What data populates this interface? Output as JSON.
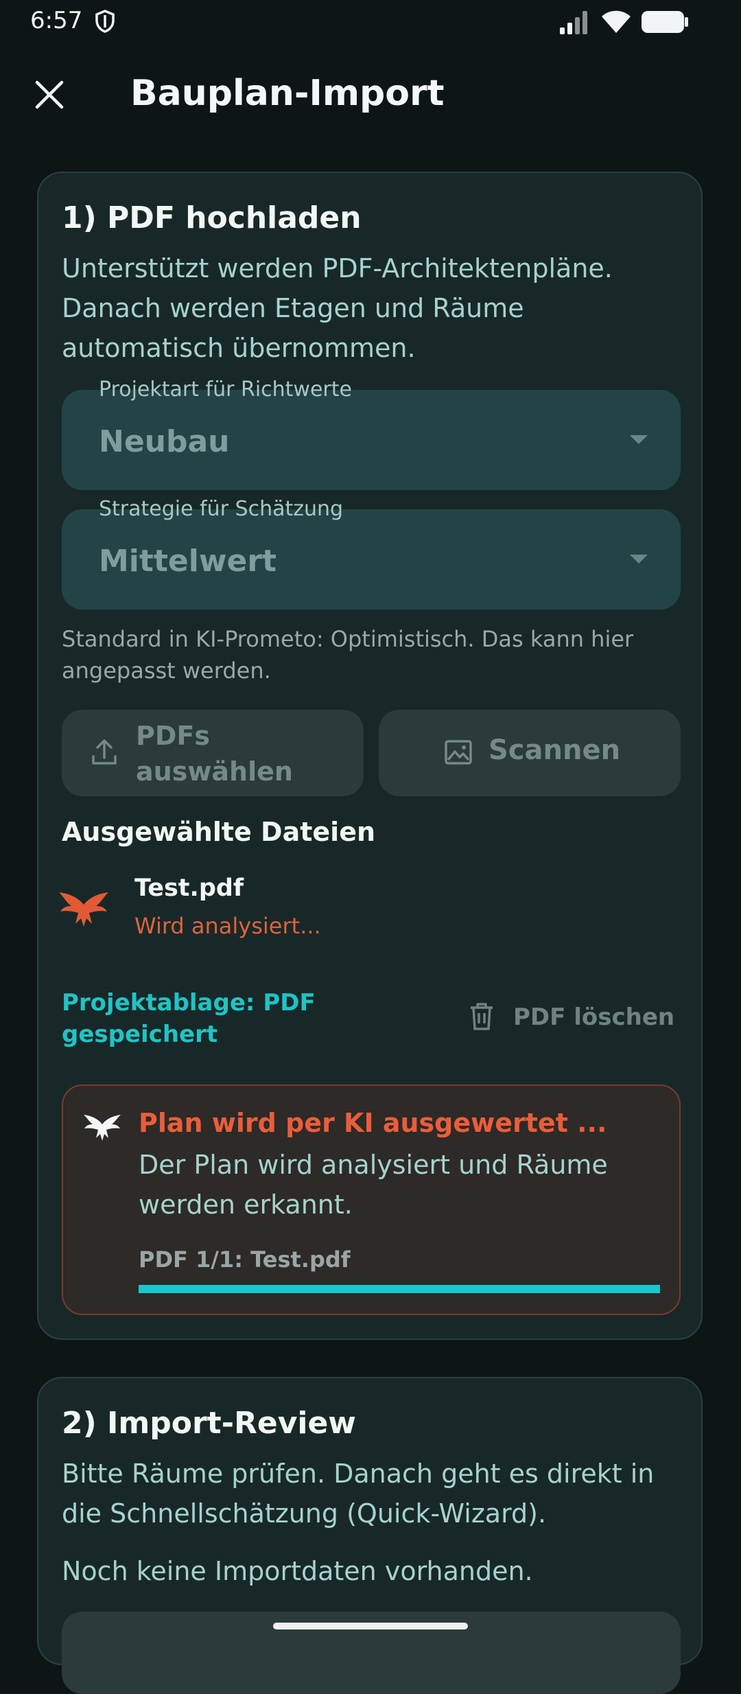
{
  "status_bar": {
    "time": "6:57"
  },
  "app_bar": {
    "title": "Bauplan-Import"
  },
  "section1": {
    "title": "1) PDF hochladen",
    "description": "Unterstützt werden PDF-Architektenpläne. Danach werden Etagen und Räume automatisch übernommen.",
    "project_type": {
      "label": "Projektart für Richtwerte",
      "value": "Neubau"
    },
    "strategy": {
      "label": "Strategie für Schätzung",
      "value": "Mittelwert"
    },
    "hint": "Standard in KI-Prometo: Optimistisch. Das kann hier angepasst werden.",
    "upload_button": "PDFs auswählen",
    "scan_button": "Scannen",
    "selected_files_label": "Ausgewählte Dateien",
    "file": {
      "name": "Test.pdf",
      "status": "Wird analysiert..."
    },
    "storage_status": "Projektablage: PDF gespeichert",
    "delete_button": "PDF löschen",
    "analysis": {
      "title": "Plan wird per KI ausgewertet ...",
      "description": "Der Plan wird analysiert und Räume werden erkannt.",
      "progress_label": "PDF 1/1: Test.pdf",
      "progress": 1.0
    }
  },
  "section2": {
    "title": "2) Import-Review",
    "description": "Bitte Räume prüfen. Danach geht es direkt in die Schnellschätzung (Quick-Wizard).",
    "empty_state": "Noch keine Importdaten vorhanden."
  },
  "colors": {
    "accent_teal": "#18c8cf",
    "accent_orange": "#ea5d3a",
    "background": "#0e1517",
    "card": "#182829"
  }
}
